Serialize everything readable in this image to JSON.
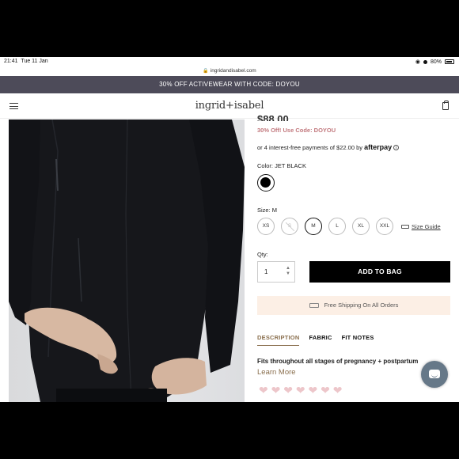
{
  "status_bar": {
    "time": "21:41",
    "date": "Tue 11 Jan",
    "battery": "80%"
  },
  "browser": {
    "url": "ingridandisabel.com"
  },
  "promo_banner": {
    "text": "30% OFF ACTIVEWEAR WITH CODE: DOYOU"
  },
  "header": {
    "logo": "ingrid+isabel"
  },
  "product": {
    "price": "$88.00",
    "promo": "30% Off! Use Code: DOYOU",
    "afterpay_text": "or 4 interest-free payments of $22.00 by",
    "afterpay_logo": "afterpay",
    "color_label": "Color: JET BLACK",
    "color_swatch": "#000000",
    "size_label": "Size: M",
    "sizes": [
      {
        "label": "XS",
        "state": "available"
      },
      {
        "label": "S",
        "state": "unavailable"
      },
      {
        "label": "M",
        "state": "selected"
      },
      {
        "label": "L",
        "state": "available"
      },
      {
        "label": "XL",
        "state": "available"
      },
      {
        "label": "XXL",
        "state": "available"
      }
    ],
    "size_guide": "Size Guide",
    "qty_label": "Qty:",
    "qty_value": "1",
    "add_to_bag": "ADD TO BAG",
    "shipping": "Free Shipping On All Orders",
    "tabs": [
      "DESCRIPTION",
      "FABRIC",
      "FIT NOTES"
    ],
    "description": "Fits throughout all stages of pregnancy + postpartum",
    "learn_more": "Learn More"
  },
  "colors": {
    "promo_banner_bg": "#4d4b59",
    "promo_text": "#c2797e",
    "accent": "#8a6f4e",
    "shipping_bg": "#fcefe5",
    "chat_bg": "#667888"
  }
}
